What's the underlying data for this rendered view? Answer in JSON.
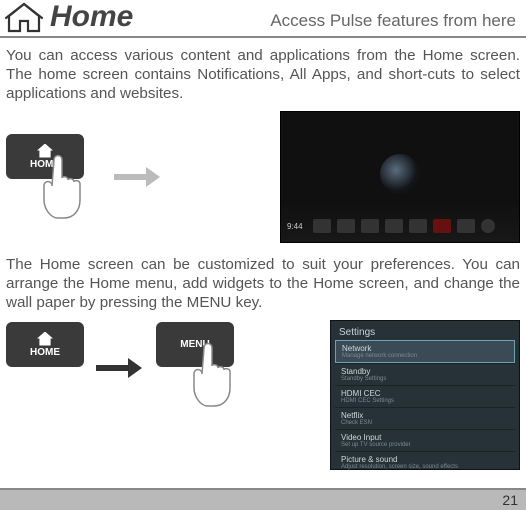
{
  "header": {
    "title": "Home",
    "subtitle": "Access Pulse features from here"
  },
  "intro": "You can access various content and applications from the Home screen. The home screen contains Notifications, All Apps, and short-cuts to select applications and websites.",
  "remote": {
    "home_label": "HOME",
    "menu_label": "MENU"
  },
  "tv": {
    "time": "9:44"
  },
  "customize_text": "The Home screen can be customized to suit your preferences. You can arrange the Home menu, add widgets to the Home screen, and change the wall paper by pressing the MENU key.",
  "settings": {
    "title": "Settings",
    "items": [
      {
        "title": "Network",
        "sub": "Manage network connection"
      },
      {
        "title": "Standby",
        "sub": "Standby Settings"
      },
      {
        "title": "HDMI CEC",
        "sub": "HDMI CEC Settings"
      },
      {
        "title": "Netflix",
        "sub": "Check ESN"
      },
      {
        "title": "Video Input",
        "sub": "Set up TV source provider"
      },
      {
        "title": "Picture & sound",
        "sub": "Adjust resolution, screen size, sound effects"
      }
    ]
  },
  "page_number": "21"
}
